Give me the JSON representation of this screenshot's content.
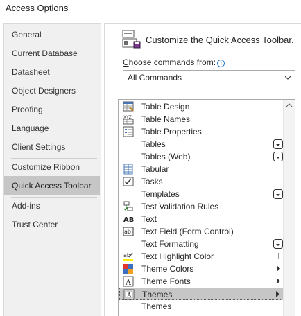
{
  "window": {
    "title": "Access Options"
  },
  "sidebar": {
    "items": [
      {
        "label": "General"
      },
      {
        "label": "Current Database"
      },
      {
        "label": "Datasheet"
      },
      {
        "label": "Object Designers"
      },
      {
        "label": "Proofing"
      },
      {
        "label": "Language"
      },
      {
        "label": "Client Settings"
      },
      {
        "label": "Customize Ribbon"
      },
      {
        "label": "Quick Access Toolbar"
      },
      {
        "label": "Add-ins"
      },
      {
        "label": "Trust Center"
      }
    ],
    "active": "Quick Access Toolbar"
  },
  "main": {
    "heading": "Customize the Quick Access Toolbar.",
    "choose_label_prefix": "C",
    "choose_label_rest": "hoose commands from:",
    "choose_value": "All Commands"
  },
  "commands": [
    {
      "label": "Table Design",
      "icon": "table-design-icon",
      "mark": ""
    },
    {
      "label": "Table Names",
      "icon": "table-names-icon",
      "mark": ""
    },
    {
      "label": "Table Properties",
      "icon": "table-properties-icon",
      "mark": ""
    },
    {
      "label": "Tables",
      "icon": "",
      "mark": "gallery"
    },
    {
      "label": "Tables (Web)",
      "icon": "",
      "mark": "gallery"
    },
    {
      "label": "Tabular",
      "icon": "tabular-icon",
      "mark": ""
    },
    {
      "label": "Tasks",
      "icon": "tasks-icon",
      "mark": ""
    },
    {
      "label": "Templates",
      "icon": "",
      "mark": "gallery"
    },
    {
      "label": "Test Validation Rules",
      "icon": "test-validation-icon",
      "mark": ""
    },
    {
      "label": "Text",
      "icon": "text-ab-icon",
      "mark": ""
    },
    {
      "label": "Text Field (Form Control)",
      "icon": "text-field-icon",
      "mark": ""
    },
    {
      "label": "Text Formatting",
      "icon": "",
      "mark": "gallery"
    },
    {
      "label": "Text Highlight Color",
      "icon": "highlight-icon",
      "mark": "split"
    },
    {
      "label": "Theme Colors",
      "icon": "theme-colors-icon",
      "mark": "submenu"
    },
    {
      "label": "Theme Fonts",
      "icon": "theme-fonts-icon",
      "mark": "submenu"
    },
    {
      "label": "Themes",
      "icon": "themes-icon",
      "mark": "submenu",
      "selected": true
    },
    {
      "label": "Themes",
      "icon": "",
      "mark": ""
    }
  ],
  "colors": {
    "selected_row": "#c6c6c6",
    "active_nav": "#c6c6c6",
    "sidebar_bg": "#f0f0f0",
    "accent": "#2b7cd3"
  }
}
